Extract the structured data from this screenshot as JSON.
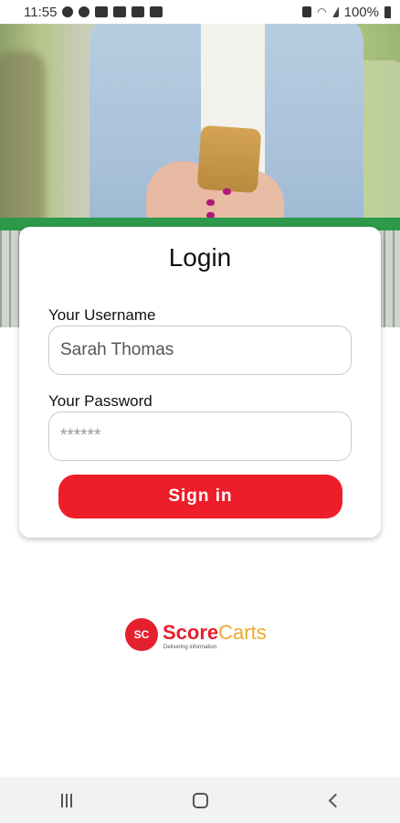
{
  "status_bar": {
    "time": "11:55",
    "battery": "100%",
    "icons": [
      "account-circle-icon",
      "sync-icon",
      "download-icon",
      "image-icon",
      "youtube-icon",
      "youtube-icon",
      "lock-icon",
      "wifi-icon",
      "signal-icon",
      "battery-icon"
    ]
  },
  "hero": {
    "icon": "shopping-photo"
  },
  "login": {
    "title": "Login",
    "username_label": "Your Username",
    "username_value": "Sarah Thomas",
    "password_label": "Your Password",
    "password_placeholder": "******",
    "signin_label": "Sign in",
    "accent_color": "#ee1d2a"
  },
  "logo": {
    "brand_score": "Score",
    "brand_carts": "Carts",
    "badge_text": "SC",
    "tagline": "Delivering information",
    "colors": {
      "primary": "#e5202e",
      "secondary": "#f0a82a"
    }
  },
  "nav_bar": {
    "items": [
      "recents-icon",
      "home-icon",
      "back-icon"
    ]
  }
}
